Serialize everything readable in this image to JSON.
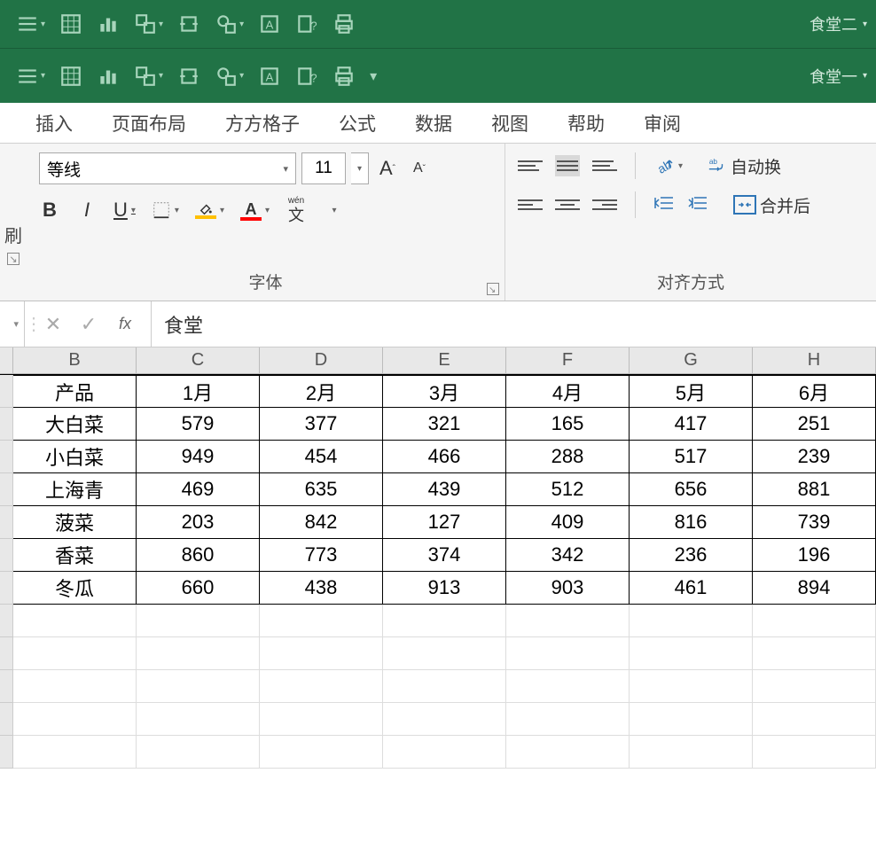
{
  "topbar1": {
    "workbook_label": "食堂二"
  },
  "topbar2": {
    "workbook_label": "食堂一"
  },
  "menu": {
    "tabs": [
      "插入",
      "页面布局",
      "方方格子",
      "公式",
      "数据",
      "视图",
      "帮助",
      "审阅"
    ]
  },
  "ribbon": {
    "clipboard_partial": "刷",
    "font": {
      "name": "等线",
      "size": "11",
      "increase_label": "A",
      "decrease_label": "A",
      "bold": "B",
      "italic": "I",
      "underline": "U",
      "wen": "wén",
      "group_label": "字体"
    },
    "align": {
      "group_label": "对齐方式",
      "wrap_text": "自动换",
      "merge": "合并后"
    }
  },
  "formula_bar": {
    "value": "食堂",
    "fx": "fx"
  },
  "sheet": {
    "columns": [
      "B",
      "C",
      "D",
      "E",
      "F",
      "G",
      "H"
    ],
    "header_row": [
      "产品",
      "1月",
      "2月",
      "3月",
      "4月",
      "5月",
      "6月"
    ],
    "rows": [
      [
        "大白菜",
        "579",
        "377",
        "321",
        "165",
        "417",
        "251"
      ],
      [
        "小白菜",
        "949",
        "454",
        "466",
        "288",
        "517",
        "239"
      ],
      [
        "上海青",
        "469",
        "635",
        "439",
        "512",
        "656",
        "881"
      ],
      [
        "菠菜",
        "203",
        "842",
        "127",
        "409",
        "816",
        "739"
      ],
      [
        "香菜",
        "860",
        "773",
        "374",
        "342",
        "236",
        "196"
      ],
      [
        "冬瓜",
        "660",
        "438",
        "913",
        "903",
        "461",
        "894"
      ]
    ],
    "empty_rows": 5
  }
}
